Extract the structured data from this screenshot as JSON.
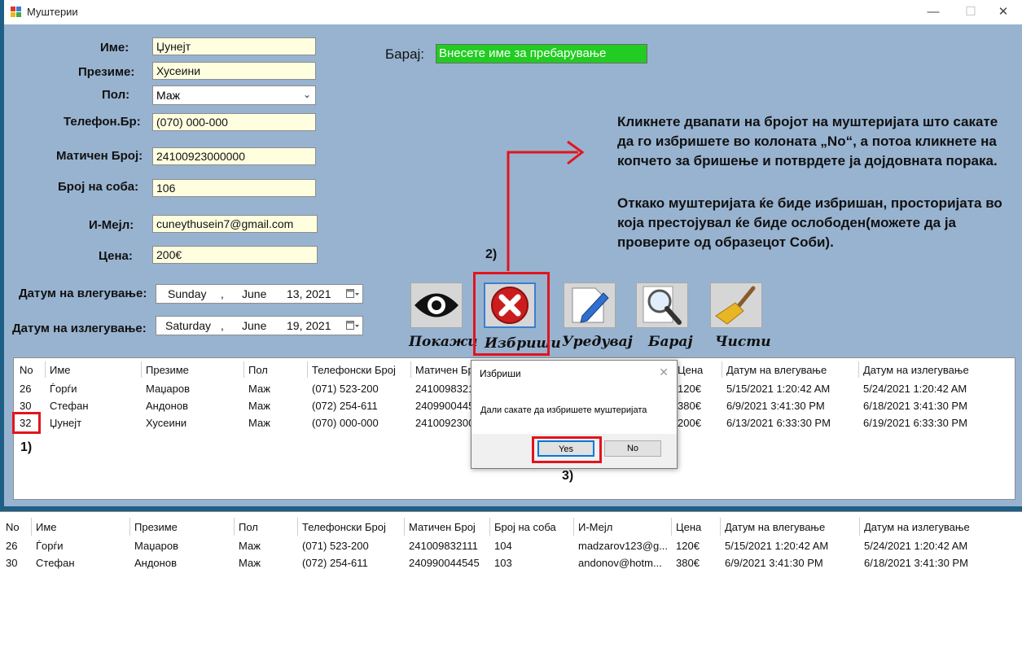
{
  "window": {
    "title": "Муштерии",
    "minimize": "—",
    "maximize": "☐",
    "close": "✕"
  },
  "form": {
    "name_label": "Име:",
    "name_value": "Џунејт",
    "surname_label": "Презиме:",
    "surname_value": "Хусеини",
    "gender_label": "Пол:",
    "gender_value": "Маж",
    "phone_label": "Телефон.Бр:",
    "phone_value": "(070) 000-000",
    "embg_label": "Матичен Број:",
    "embg_value": "24100923000000",
    "room_label": "Број на соба:",
    "room_value": "106",
    "email_label": "И-Мејл:",
    "email_value": "cuneythusein7@gmail.com",
    "price_label": "Цена:",
    "price_value": "200€",
    "checkin_label": "Датум на влегување:",
    "checkin": {
      "weekday": "Sunday",
      "sep": ",",
      "month": "June",
      "day_year": "13, 2021"
    },
    "checkout_label": "Датум на излегување:",
    "checkout": {
      "weekday": "Saturday",
      "sep": ",",
      "month": "June",
      "day_year": "19, 2021"
    }
  },
  "search": {
    "label": "Барај:",
    "value": "Внесете име за пребарување"
  },
  "instructions": {
    "p1": "Кликнете двапати на бројот на муштеријата што сакате да го избришете во колоната „No“, а потоа кликнете на копчето за бришење и потврдете ја дојдовната порака.",
    "p2": "Откако муштеријата ќе биде избришан, просторијата во која престојувал ќе биде ослободен(можете да ја проверите од образецот Соби)."
  },
  "toolbar": {
    "show": "Покажи",
    "delete": "Избриши",
    "edit": "Уредувај",
    "search": "Барај",
    "clear": "Чисти"
  },
  "annotations": {
    "step1": "1)",
    "step2": "2)",
    "step3": "3)"
  },
  "grid1": {
    "columns": [
      "No",
      "Име",
      "Презиме",
      "Пол",
      "Телефонски Број",
      "Матичен Бр",
      "Цена",
      "Датум на влегување",
      "Датум на излегување"
    ],
    "rows": [
      [
        "26",
        "Ѓорѓи",
        "Маџаров",
        "Маж",
        "(071) 523-200",
        "24100983211",
        "120€",
        "5/15/2021 1:20:42 AM",
        "5/24/2021 1:20:42 AM"
      ],
      [
        "30",
        "Стефан",
        "Андонов",
        "Маж",
        "(072) 254-611",
        "24099004454",
        "380€",
        "6/9/2021 3:41:30 PM",
        "6/18/2021 3:41:30 PM"
      ],
      [
        "32",
        "Џунејт",
        "Хусеини",
        "Маж",
        "(070) 000-000",
        "24100923000",
        "200€",
        "6/13/2021 6:33:30 PM",
        "6/19/2021 6:33:30 PM"
      ]
    ]
  },
  "dialog": {
    "title": "Избриши",
    "close": "✕",
    "message": "Дали сакате да избришете муштеријата",
    "yes": "Yes",
    "no": "No"
  },
  "grid2": {
    "columns": [
      "No",
      "Име",
      "Презиме",
      "Пол",
      "Телефонски Број",
      "Матичен Број",
      "Број на соба",
      "И-Мејл",
      "Цена",
      "Датум на влегување",
      "Датум на излегување"
    ],
    "rows": [
      [
        "26",
        "Ѓорѓи",
        "Маџаров",
        "Маж",
        "(071) 523-200",
        "241009832111",
        "104",
        "madzarov123@g...",
        "120€",
        "5/15/2021 1:20:42 AM",
        "5/24/2021 1:20:42 AM"
      ],
      [
        "30",
        "Стефан",
        "Андонов",
        "Маж",
        "(072) 254-611",
        "240990044545",
        "103",
        "andonov@hotm...",
        "380€",
        "6/9/2021 3:41:30 PM",
        "6/18/2021 3:41:30 PM"
      ]
    ]
  }
}
